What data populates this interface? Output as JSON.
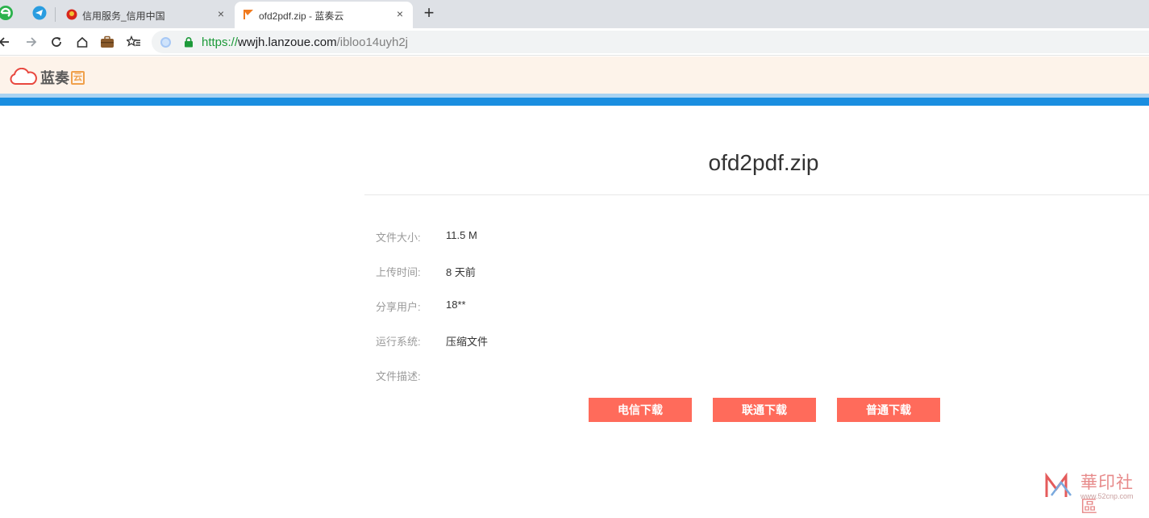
{
  "browser": {
    "tabs": [
      {
        "title": "信用服务_信用中国",
        "active": false
      },
      {
        "title": "ofd2pdf.zip - 蓝奏云",
        "active": true
      }
    ],
    "close_glyph": "×",
    "new_tab_glyph": "+",
    "url": {
      "scheme": "https://",
      "host": "wwjh.lanzoue.com",
      "path": "/ibloo14uyh2j"
    }
  },
  "site": {
    "logo_text": "蓝奏",
    "logo_badge": "云",
    "accent_color": "#1a8ee0",
    "header_bg": "#fdf3ea"
  },
  "file": {
    "title": "ofd2pdf.zip",
    "info": [
      {
        "label": "文件大小:",
        "value": "11.5 M"
      },
      {
        "label": "上传时间:",
        "value": "8 天前"
      },
      {
        "label": "分享用户:",
        "value": "18**"
      },
      {
        "label": "运行系统:",
        "value": "压缩文件"
      },
      {
        "label": "文件描述:",
        "value": ""
      }
    ],
    "buttons": [
      {
        "label": "电信下载"
      },
      {
        "label": "联通下载"
      },
      {
        "label": "普通下载"
      }
    ],
    "button_color": "#ff6b5b"
  },
  "watermark": {
    "text": "華印社區",
    "sub": "www.52cnp.com"
  }
}
